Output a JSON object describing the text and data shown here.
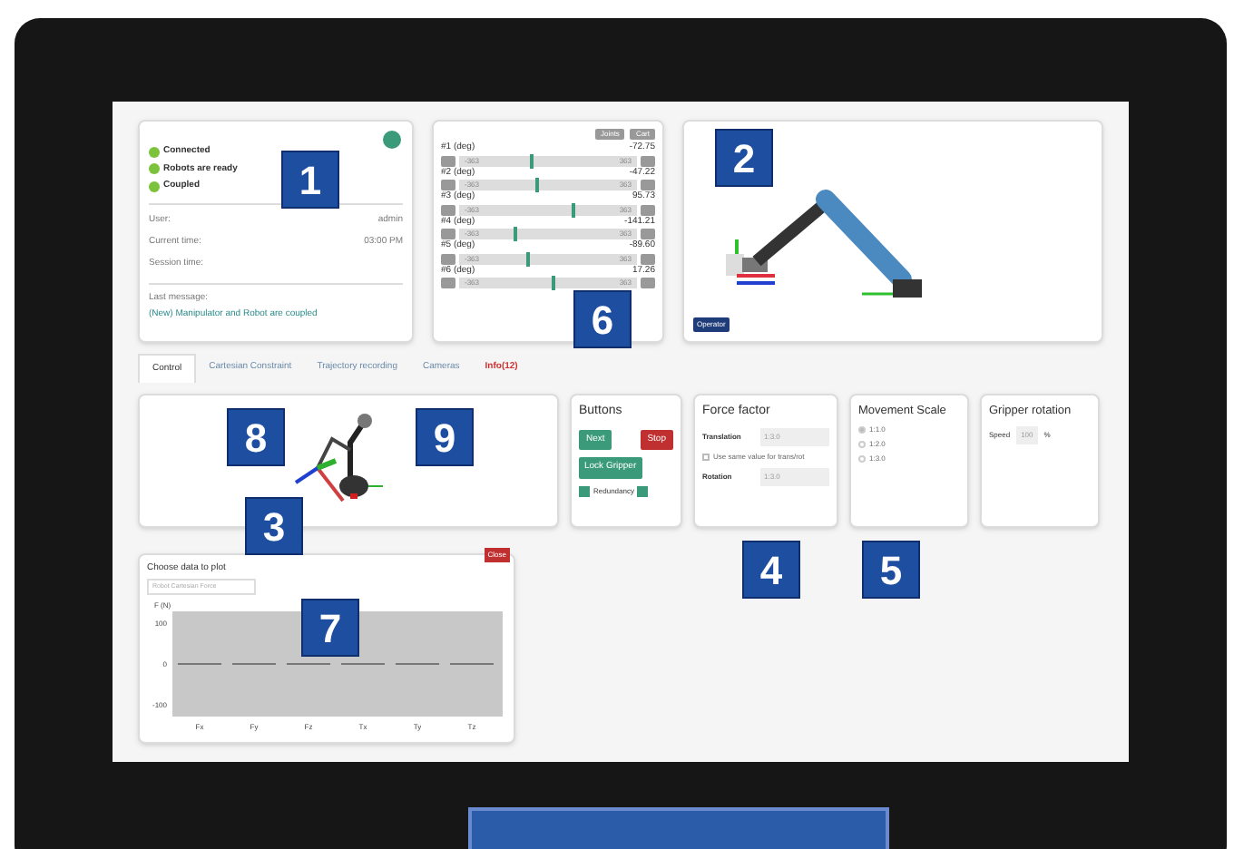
{
  "status": {
    "items": [
      {
        "label": "Connected",
        "on": true
      },
      {
        "label": "Robots are ready",
        "on": true
      },
      {
        "label": "Coupled",
        "on": true
      }
    ],
    "fields": [
      {
        "label": "User:",
        "value": "admin"
      },
      {
        "label": "Current time:",
        "value": "03:00 PM"
      },
      {
        "label": "Session time:"
      }
    ],
    "message_label": "Last message:",
    "message": "(New) Manipulator and Robot are coupled"
  },
  "joints": {
    "buttons": [
      "Joints",
      "Cart"
    ],
    "sliders": [
      {
        "label": "#1 (deg)",
        "reading": "-72.75",
        "min": "-363",
        "max": "363",
        "level": 0.4
      },
      {
        "label": "#2 (deg)",
        "reading": "-47.22",
        "min": "-363",
        "max": "363",
        "level": 0.43
      },
      {
        "label": "#3 (deg)",
        "reading": "95.73",
        "min": "-363",
        "max": "363",
        "level": 0.63
      },
      {
        "label": "#4 (deg)",
        "reading": "-141.21",
        "min": "-363",
        "max": "363",
        "level": 0.31
      },
      {
        "label": "#5 (deg)",
        "reading": "-89.60",
        "min": "-363",
        "max": "363",
        "level": 0.38
      },
      {
        "label": "#6 (deg)",
        "reading": "17.26",
        "min": "-363",
        "max": "363",
        "level": 0.52
      }
    ]
  },
  "viewer": {
    "badge": "Operator"
  },
  "tabs": [
    {
      "label": "Control",
      "selected": true,
      "alert": false
    },
    {
      "label": "Cartesian Constraint",
      "selected": false,
      "alert": false
    },
    {
      "label": "Trajectory recording",
      "selected": false,
      "alert": false
    },
    {
      "label": "Cameras",
      "selected": false,
      "alert": false
    },
    {
      "label": "Info(12)",
      "selected": false,
      "alert": true
    }
  ],
  "buttons_card": {
    "title": "Buttons",
    "next": "Next",
    "stop": "Stop",
    "lock": "Lock Gripper",
    "redundancy": "Redundancy"
  },
  "force": {
    "title": "Force factor",
    "translation_label": "Translation",
    "translation": "1:3.0",
    "same_label": "Use same value for trans/rot",
    "same": false,
    "rotation_label": "Rotation",
    "rotation": "1:3.0"
  },
  "movement": {
    "title": "Movement Scale",
    "options": [
      {
        "label": "1:1.0",
        "selected": true
      },
      {
        "label": "1:2.0",
        "selected": false
      },
      {
        "label": "1:3.0",
        "selected": false
      }
    ]
  },
  "gripper": {
    "title": "Gripper rotation",
    "speed_label": "Speed",
    "speed": "100",
    "unit": "%"
  },
  "plot": {
    "title": "Choose data to plot",
    "select": "Robot Cartesian Force",
    "close": "Close",
    "chart_data": {
      "type": "bar",
      "ylabel": "F (N)",
      "categories": [
        "Fx",
        "Fy",
        "Fz",
        "Tx",
        "Ty",
        "Tz"
      ],
      "values": [
        0,
        0,
        0,
        0,
        0,
        0
      ],
      "ylim": [
        -130,
        130
      ],
      "yticks": [
        -100,
        0,
        100
      ]
    }
  },
  "callouts": [
    "1",
    "2",
    "3",
    "4",
    "5",
    "6",
    "7",
    "8",
    "9"
  ]
}
